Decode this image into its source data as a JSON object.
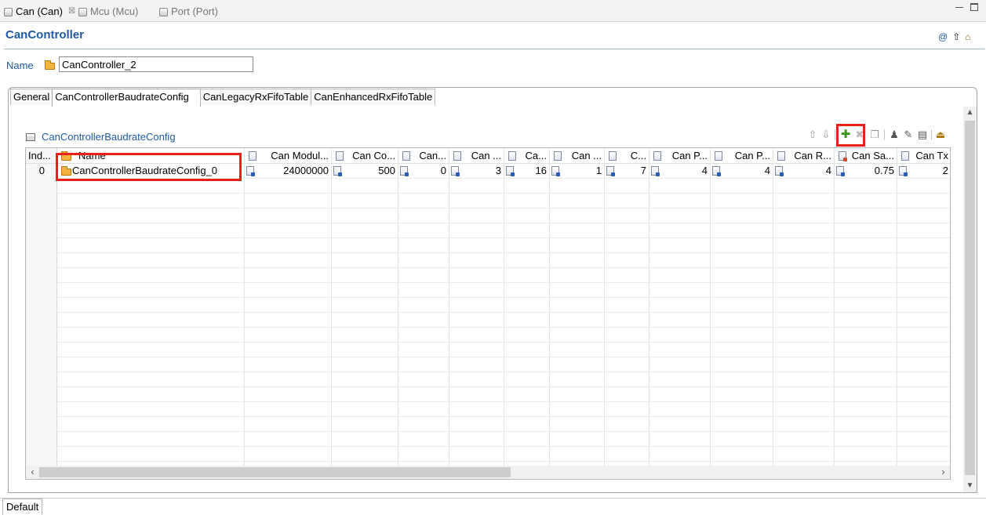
{
  "editor_tabs": [
    {
      "label": "Can (Can)",
      "active": true,
      "close": "☒"
    },
    {
      "label": "Mcu (Mcu)",
      "active": false
    },
    {
      "label": "Port (Port)",
      "active": false
    }
  ],
  "header": {
    "title": "CanController"
  },
  "name_field": {
    "label": "Name",
    "value": "CanController_2"
  },
  "folder_tabs": [
    {
      "label": "General",
      "active": false
    },
    {
      "label": "CanControllerBaudrateConfig",
      "active": true
    },
    {
      "label": "CanLegacyRxFifoTable",
      "active": false
    },
    {
      "label": "CanEnhancedRxFifoTable",
      "active": false
    }
  ],
  "section": {
    "title": "CanControllerBaudrateConfig"
  },
  "table": {
    "headers": [
      "Ind...",
      "Name",
      "Can Modul...",
      "Can Co...",
      "Can...",
      "Can ...",
      "Ca...",
      "Can ...",
      "C...",
      "Can P...",
      "Can P...",
      "Can R...",
      "Can Sa...",
      "Can Tx"
    ],
    "rows": [
      {
        "index": "0",
        "name": "CanControllerBaudrateConfig_0",
        "values": [
          "24000000",
          "500",
          "0",
          "3",
          "16",
          "1",
          "7",
          "4",
          "4",
          "4",
          "0.75",
          "2"
        ]
      }
    ]
  },
  "bottom_tab": {
    "label": "Default"
  },
  "colors": {
    "accent": "#1d5aa7",
    "highlight": "#e8201a",
    "add_icon": "#3a9a1a"
  },
  "icons": [
    "plugin-icon",
    "close-icon",
    "minimize-icon",
    "maximize-icon",
    "at-icon",
    "up-icon",
    "home-icon",
    "folder-icon",
    "table-icon",
    "move-up-icon",
    "move-down-icon",
    "add-icon",
    "remove-icon",
    "copy-icon",
    "user-icon",
    "edit-icon",
    "properties-icon",
    "export-icon"
  ]
}
